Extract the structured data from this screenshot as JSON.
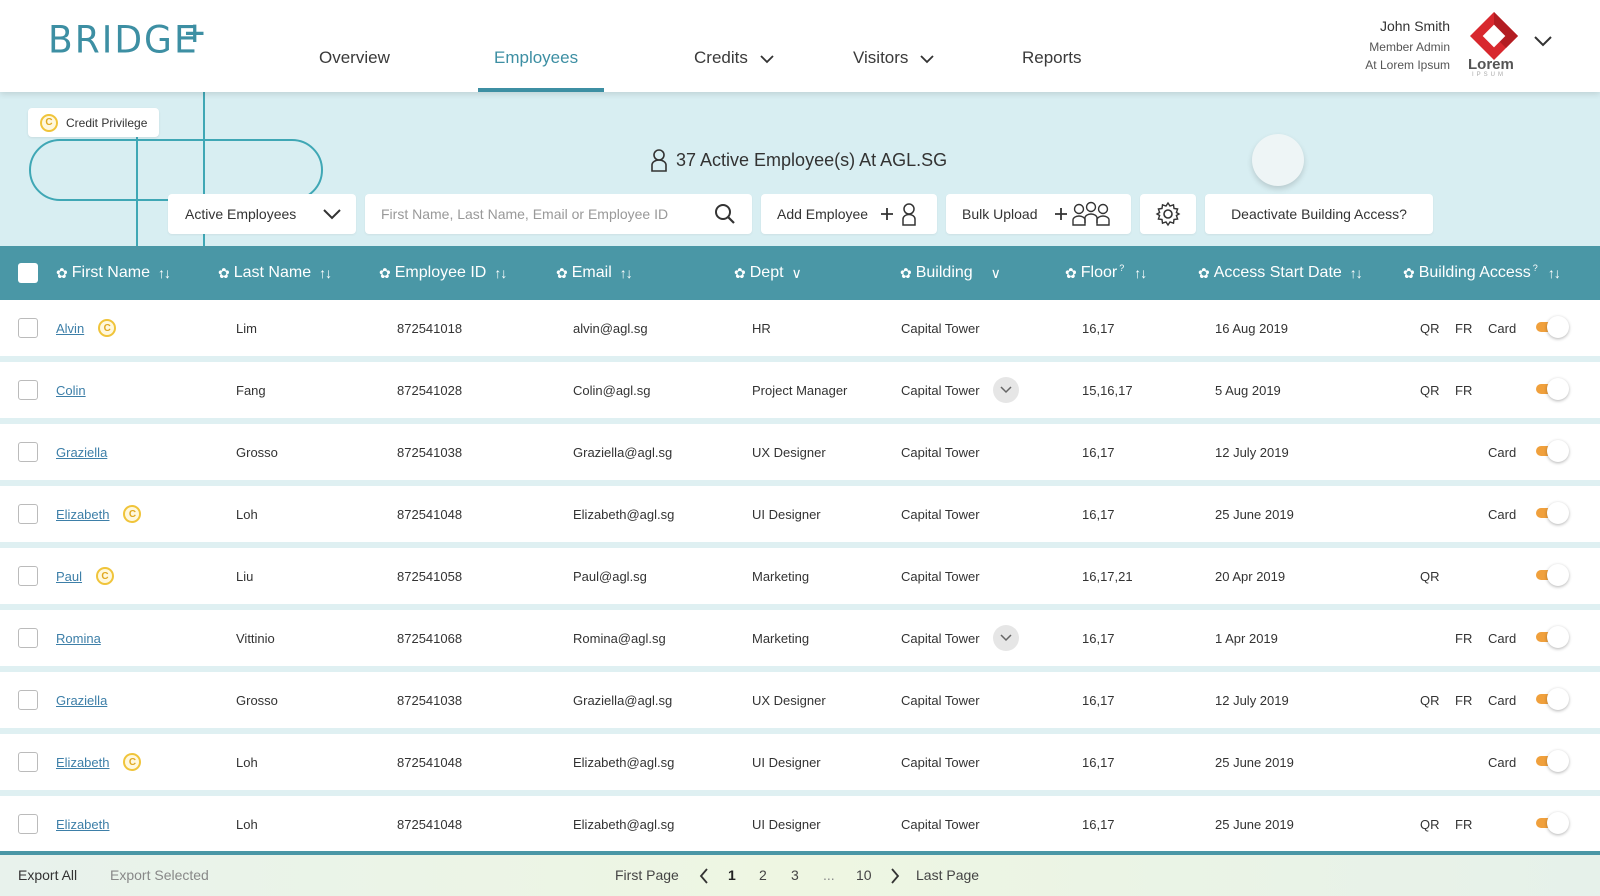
{
  "header": {
    "logo": "BRIDGE",
    "logo_plus": "+",
    "nav": [
      {
        "label": "Overview",
        "active": false
      },
      {
        "label": "Employees",
        "active": true
      },
      {
        "label": "Credits",
        "active": false,
        "dropdown": true
      },
      {
        "label": "Visitors",
        "active": false,
        "dropdown": true
      },
      {
        "label": "Reports",
        "active": false
      }
    ],
    "user": {
      "name": "John Smith",
      "role": "Member Admin",
      "org": "At Lorem Ipsum"
    },
    "brand": {
      "name": "Lorem",
      "sub": "IPSUM"
    }
  },
  "banner": {
    "credit_privilege": "Credit Privilege",
    "coin_symbol": "C",
    "active_count": "37 Active Employee(s) At AGL.SG",
    "filter_select": "Active Employees",
    "search_placeholder": "First Name, Last Name, Email or Employee ID",
    "add_employee": "Add Employee",
    "bulk_upload": "Bulk Upload",
    "deactivate": "Deactivate Building Access?"
  },
  "columns": [
    {
      "label": "First Name",
      "suffix": "↑↓"
    },
    {
      "label": "Last Name",
      "suffix": "↑↓"
    },
    {
      "label": "Employee ID",
      "suffix": "↑↓"
    },
    {
      "label": "Email",
      "suffix": "↑↓"
    },
    {
      "label": "Dept",
      "suffix": "∨"
    },
    {
      "label": "Building",
      "suffix": "∨"
    },
    {
      "label": "Floor",
      "sup": "?",
      "suffix": "↑↓"
    },
    {
      "label": "Access Start Date",
      "suffix": "↑↓"
    },
    {
      "label": "Building Access",
      "sup": "?",
      "suffix": "↑↓"
    }
  ],
  "rows": [
    {
      "first": "Alvin",
      "credit": true,
      "last": "Lim",
      "id": "872541018",
      "email": "alvin@agl.sg",
      "dept": "HR",
      "building": "Capital Tower",
      "bchev": false,
      "floor": "16,17",
      "start": "16 Aug 2019",
      "qr": "QR",
      "fr": "FR",
      "card": "Card"
    },
    {
      "first": "Colin",
      "credit": false,
      "last": "Fang",
      "id": "872541028",
      "email": "Colin@agl.sg",
      "dept": "Project Manager",
      "building": "Capital Tower",
      "bchev": true,
      "floor": "15,16,17",
      "start": "5 Aug 2019",
      "qr": "QR",
      "fr": "FR",
      "card": ""
    },
    {
      "first": "Graziella",
      "credit": false,
      "last": "Grosso",
      "id": "872541038",
      "email": "Graziella@agl.sg",
      "dept": "UX Designer",
      "building": "Capital Tower",
      "bchev": false,
      "floor": "16,17",
      "start": "12 July 2019",
      "qr": "",
      "fr": "",
      "card": "Card"
    },
    {
      "first": "Elizabeth",
      "credit": true,
      "last": "Loh",
      "id": "872541048",
      "email": "Elizabeth@agl.sg",
      "dept": "UI Designer",
      "building": "Capital Tower",
      "bchev": false,
      "floor": "16,17",
      "start": "25 June 2019",
      "qr": "",
      "fr": "",
      "card": "Card"
    },
    {
      "first": "Paul",
      "credit": true,
      "last": "Liu",
      "id": "872541058",
      "email": "Paul@agl.sg",
      "dept": "Marketing",
      "building": "Capital Tower",
      "bchev": false,
      "floor": "16,17,21",
      "start": "20 Apr 2019",
      "qr": "QR",
      "fr": "",
      "card": ""
    },
    {
      "first": "Romina",
      "credit": false,
      "last": "Vittinio",
      "id": "872541068",
      "email": "Romina@agl.sg",
      "dept": "Marketing",
      "building": "Capital Tower",
      "bchev": true,
      "floor": "16,17",
      "start": "1 Apr 2019",
      "qr": "",
      "fr": "FR",
      "card": "Card"
    },
    {
      "first": "Graziella",
      "credit": false,
      "last": "Grosso",
      "id": "872541038",
      "email": "Graziella@agl.sg",
      "dept": "UX Designer",
      "building": "Capital Tower",
      "bchev": false,
      "floor": "16,17",
      "start": "12 July 2019",
      "qr": "QR",
      "fr": "FR",
      "card": "Card"
    },
    {
      "first": "Elizabeth",
      "credit": true,
      "last": "Loh",
      "id": "872541048",
      "email": "Elizabeth@agl.sg",
      "dept": "UI Designer",
      "building": "Capital Tower",
      "bchev": false,
      "floor": "16,17",
      "start": "25 June 2019",
      "qr": "",
      "fr": "",
      "card": "Card"
    },
    {
      "first": "Elizabeth",
      "credit": false,
      "last": "Loh",
      "id": "872541048",
      "email": "Elizabeth@agl.sg",
      "dept": "UI Designer",
      "building": "Capital Tower",
      "bchev": false,
      "floor": "16,17",
      "start": "25 June 2019",
      "qr": "QR",
      "fr": "FR",
      "card": ""
    }
  ],
  "footer": {
    "export_all": "Export All",
    "export_selected": "Export Selected",
    "first_page": "First Page",
    "pages": [
      "1",
      "2",
      "3",
      "...",
      "10"
    ],
    "current_page": "1",
    "last_page": "Last Page"
  },
  "colors": {
    "accent": "#3d8fa3",
    "header_bg": "#4a97a6",
    "banner_bg": "#d8eef2",
    "toggle_on": "#f0a03c",
    "coin": "#f0c43a",
    "brand_red": "#d8282e"
  }
}
